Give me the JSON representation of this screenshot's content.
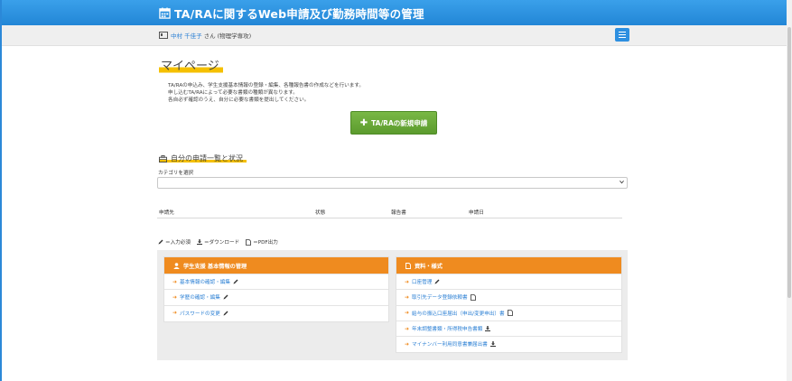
{
  "app": {
    "title": "TA/RAに関するWeb申請及び勤務時間等の管理"
  },
  "user": {
    "name": "中村 千佳子",
    "honorific": "さん",
    "affiliation": "(物理学専攻)"
  },
  "page": {
    "title": "マイページ",
    "description": [
      "TA/RAの申込み、学生支援基本情報の登録・編集、各種報告書の作成などを行います。",
      "申し込むTA/RAによって必要な書類の種類が異なります。",
      "各自必ず確認のうえ、自分に必要な書類を提出してください。"
    ],
    "new_application_button": "TA/RAの新規申請"
  },
  "applications": {
    "section_title": "自分の申請一覧と状況",
    "category_label": "カテゴリを選択",
    "category_selected": "",
    "columns": [
      "申請先",
      "状態",
      "報告書",
      "申請日"
    ]
  },
  "legend": {
    "edit": "＝入力必須",
    "download": "＝ダウンロード",
    "pdf": "＝PDF出力"
  },
  "panels": {
    "student": {
      "title": "学生支援 基本情報の管理",
      "items": [
        {
          "label": "基本情報の確認・編集",
          "icon": "pencil-icon"
        },
        {
          "label": "学歴の確認・編集",
          "icon": "pencil-icon"
        },
        {
          "label": "パスワードの変更",
          "icon": "pencil-icon"
        }
      ]
    },
    "documents": {
      "title": "資料・様式",
      "items": [
        {
          "label": "口座管理",
          "icon": "pencil-icon"
        },
        {
          "label": "取引先データ登録依頼書",
          "icon": "pdf-icon"
        },
        {
          "label": "給与の振込口座届出（申出/変更申出）書",
          "icon": "pdf-icon"
        },
        {
          "label": "年末調整書類・所得税申告書類",
          "icon": "download-icon"
        },
        {
          "label": "マイナンバー利用同意書兼届出書",
          "icon": "download-icon"
        }
      ]
    }
  },
  "colors": {
    "header": "#2a8fe0",
    "accent_orange": "#ef8b1f",
    "highlight_yellow": "#f5c000",
    "button_green": "#6aab38",
    "link_blue": "#2a7fd4"
  }
}
